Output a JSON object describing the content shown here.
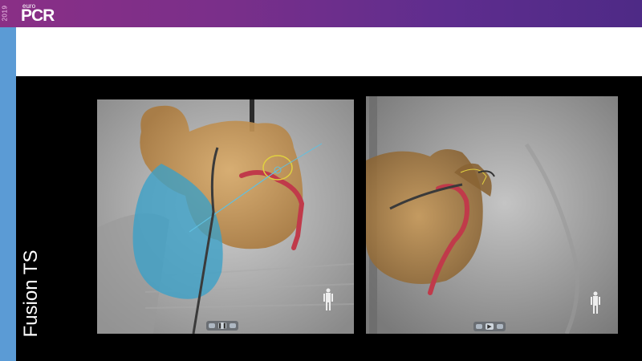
{
  "header": {
    "year": "2019",
    "brand_small": "euro",
    "brand_large": "PCR"
  },
  "slide": {
    "title": "Fusion TS"
  },
  "colors": {
    "header_purple": "#7a2f8a",
    "side_blue": "#5b9bd5",
    "heart_orange": "#c89a5a",
    "ventricle_blue": "#3aa0c8",
    "vessel_red": "#c03a4a"
  },
  "left_panel": {
    "icon": "human-figure-icon",
    "controls": [
      "prev-icon",
      "pause-icon",
      "next-icon"
    ]
  },
  "right_panel": {
    "icon": "human-figure-icon",
    "controls": [
      "prev-icon",
      "play-icon",
      "next-icon"
    ]
  }
}
